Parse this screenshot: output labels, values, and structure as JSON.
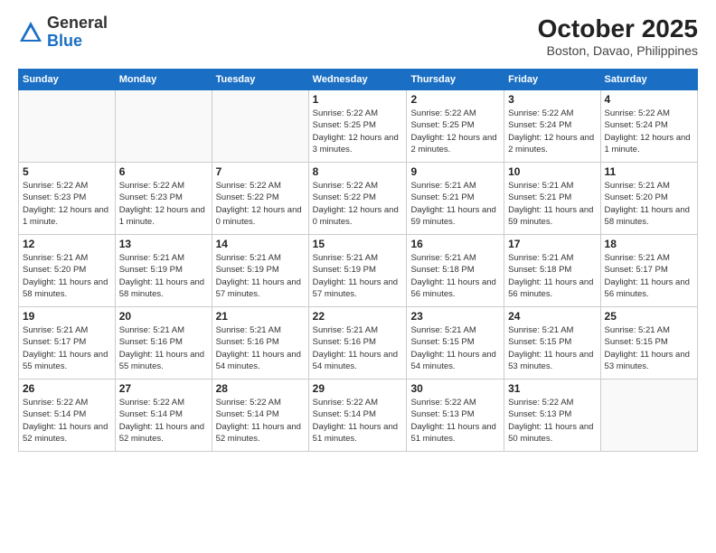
{
  "header": {
    "logo_general": "General",
    "logo_blue": "Blue",
    "month": "October 2025",
    "location": "Boston, Davao, Philippines"
  },
  "days_of_week": [
    "Sunday",
    "Monday",
    "Tuesday",
    "Wednesday",
    "Thursday",
    "Friday",
    "Saturday"
  ],
  "weeks": [
    [
      {
        "day": "",
        "info": ""
      },
      {
        "day": "",
        "info": ""
      },
      {
        "day": "",
        "info": ""
      },
      {
        "day": "1",
        "info": "Sunrise: 5:22 AM\nSunset: 5:25 PM\nDaylight: 12 hours\nand 3 minutes."
      },
      {
        "day": "2",
        "info": "Sunrise: 5:22 AM\nSunset: 5:25 PM\nDaylight: 12 hours\nand 2 minutes."
      },
      {
        "day": "3",
        "info": "Sunrise: 5:22 AM\nSunset: 5:24 PM\nDaylight: 12 hours\nand 2 minutes."
      },
      {
        "day": "4",
        "info": "Sunrise: 5:22 AM\nSunset: 5:24 PM\nDaylight: 12 hours\nand 1 minute."
      }
    ],
    [
      {
        "day": "5",
        "info": "Sunrise: 5:22 AM\nSunset: 5:23 PM\nDaylight: 12 hours\nand 1 minute."
      },
      {
        "day": "6",
        "info": "Sunrise: 5:22 AM\nSunset: 5:23 PM\nDaylight: 12 hours\nand 1 minute."
      },
      {
        "day": "7",
        "info": "Sunrise: 5:22 AM\nSunset: 5:22 PM\nDaylight: 12 hours\nand 0 minutes."
      },
      {
        "day": "8",
        "info": "Sunrise: 5:22 AM\nSunset: 5:22 PM\nDaylight: 12 hours\nand 0 minutes."
      },
      {
        "day": "9",
        "info": "Sunrise: 5:21 AM\nSunset: 5:21 PM\nDaylight: 11 hours\nand 59 minutes."
      },
      {
        "day": "10",
        "info": "Sunrise: 5:21 AM\nSunset: 5:21 PM\nDaylight: 11 hours\nand 59 minutes."
      },
      {
        "day": "11",
        "info": "Sunrise: 5:21 AM\nSunset: 5:20 PM\nDaylight: 11 hours\nand 58 minutes."
      }
    ],
    [
      {
        "day": "12",
        "info": "Sunrise: 5:21 AM\nSunset: 5:20 PM\nDaylight: 11 hours\nand 58 minutes."
      },
      {
        "day": "13",
        "info": "Sunrise: 5:21 AM\nSunset: 5:19 PM\nDaylight: 11 hours\nand 58 minutes."
      },
      {
        "day": "14",
        "info": "Sunrise: 5:21 AM\nSunset: 5:19 PM\nDaylight: 11 hours\nand 57 minutes."
      },
      {
        "day": "15",
        "info": "Sunrise: 5:21 AM\nSunset: 5:19 PM\nDaylight: 11 hours\nand 57 minutes."
      },
      {
        "day": "16",
        "info": "Sunrise: 5:21 AM\nSunset: 5:18 PM\nDaylight: 11 hours\nand 56 minutes."
      },
      {
        "day": "17",
        "info": "Sunrise: 5:21 AM\nSunset: 5:18 PM\nDaylight: 11 hours\nand 56 minutes."
      },
      {
        "day": "18",
        "info": "Sunrise: 5:21 AM\nSunset: 5:17 PM\nDaylight: 11 hours\nand 56 minutes."
      }
    ],
    [
      {
        "day": "19",
        "info": "Sunrise: 5:21 AM\nSunset: 5:17 PM\nDaylight: 11 hours\nand 55 minutes."
      },
      {
        "day": "20",
        "info": "Sunrise: 5:21 AM\nSunset: 5:16 PM\nDaylight: 11 hours\nand 55 minutes."
      },
      {
        "day": "21",
        "info": "Sunrise: 5:21 AM\nSunset: 5:16 PM\nDaylight: 11 hours\nand 54 minutes."
      },
      {
        "day": "22",
        "info": "Sunrise: 5:21 AM\nSunset: 5:16 PM\nDaylight: 11 hours\nand 54 minutes."
      },
      {
        "day": "23",
        "info": "Sunrise: 5:21 AM\nSunset: 5:15 PM\nDaylight: 11 hours\nand 54 minutes."
      },
      {
        "day": "24",
        "info": "Sunrise: 5:21 AM\nSunset: 5:15 PM\nDaylight: 11 hours\nand 53 minutes."
      },
      {
        "day": "25",
        "info": "Sunrise: 5:21 AM\nSunset: 5:15 PM\nDaylight: 11 hours\nand 53 minutes."
      }
    ],
    [
      {
        "day": "26",
        "info": "Sunrise: 5:22 AM\nSunset: 5:14 PM\nDaylight: 11 hours\nand 52 minutes."
      },
      {
        "day": "27",
        "info": "Sunrise: 5:22 AM\nSunset: 5:14 PM\nDaylight: 11 hours\nand 52 minutes."
      },
      {
        "day": "28",
        "info": "Sunrise: 5:22 AM\nSunset: 5:14 PM\nDaylight: 11 hours\nand 52 minutes."
      },
      {
        "day": "29",
        "info": "Sunrise: 5:22 AM\nSunset: 5:14 PM\nDaylight: 11 hours\nand 51 minutes."
      },
      {
        "day": "30",
        "info": "Sunrise: 5:22 AM\nSunset: 5:13 PM\nDaylight: 11 hours\nand 51 minutes."
      },
      {
        "day": "31",
        "info": "Sunrise: 5:22 AM\nSunset: 5:13 PM\nDaylight: 11 hours\nand 50 minutes."
      },
      {
        "day": "",
        "info": ""
      }
    ]
  ]
}
